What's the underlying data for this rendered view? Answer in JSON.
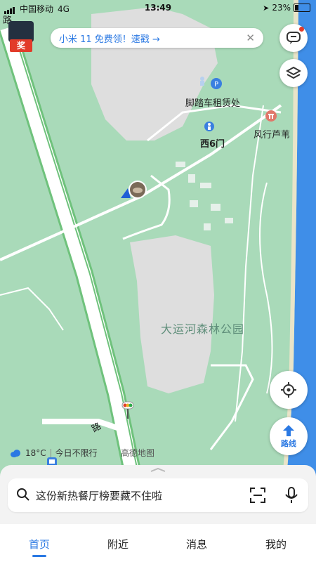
{
  "status_bar": {
    "carrier": "中国移动",
    "network": "4G",
    "time": "13:49",
    "battery": "23%"
  },
  "promo_banner": {
    "text": "小米 11 免费领！速戳 →",
    "close": "✕"
  },
  "promo_badge": {
    "label": "奖"
  },
  "map": {
    "labels": {
      "road_top": "路",
      "bike_rental": "脚踏车租赁处",
      "gate": "西6门",
      "scenic": "风行芦苇",
      "park": "大运河森林公园",
      "road_bottom": "路"
    }
  },
  "route_button": {
    "label": "路线"
  },
  "weather": {
    "temp": "18°C",
    "restriction": "今日不限行"
  },
  "map_brand": "高德地图",
  "search": {
    "placeholder": "这份新热餐厅榜要藏不住啦"
  },
  "tabs": [
    {
      "label": "首页",
      "active": true
    },
    {
      "label": "附近",
      "active": false
    },
    {
      "label": "消息",
      "active": false
    },
    {
      "label": "我的",
      "active": false
    }
  ],
  "colors": {
    "accent": "#2b79e3",
    "map_green": "#a9dab9",
    "water": "#3f8ee8",
    "badge_red": "#e23b2a"
  }
}
